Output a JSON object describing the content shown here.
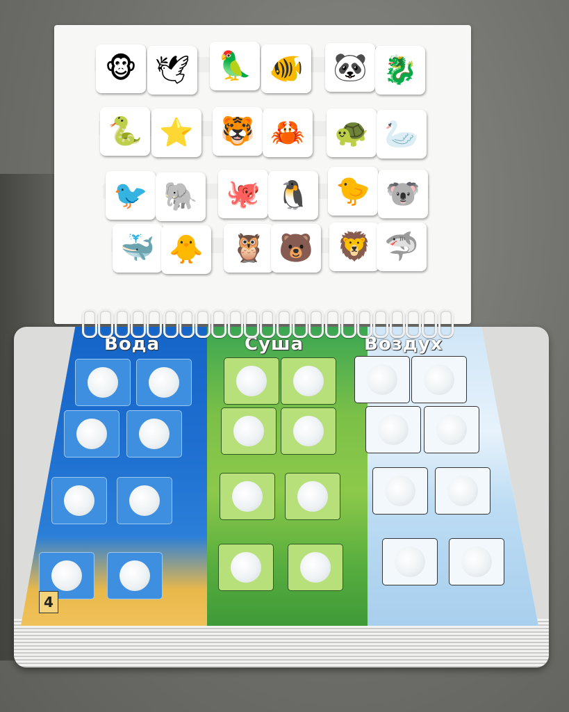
{
  "cards": [
    {
      "name": "monkey",
      "glyph": "🐵"
    },
    {
      "name": "seagull",
      "glyph": "🕊"
    },
    {
      "name": "parrot",
      "glyph": "🦜"
    },
    {
      "name": "tropical-fish",
      "glyph": "🐠"
    },
    {
      "name": "panda",
      "glyph": "🐼"
    },
    {
      "name": "seahorse",
      "glyph": "🐉"
    },
    {
      "name": "snake",
      "glyph": "🐍"
    },
    {
      "name": "starfish",
      "glyph": "⭐"
    },
    {
      "name": "tiger",
      "glyph": "🐯"
    },
    {
      "name": "crab",
      "glyph": "🦀"
    },
    {
      "name": "turtle",
      "glyph": "🐢"
    },
    {
      "name": "pelican",
      "glyph": "🦢"
    },
    {
      "name": "toucan",
      "glyph": "🐦"
    },
    {
      "name": "elephant",
      "glyph": "🐘"
    },
    {
      "name": "octopus",
      "glyph": "🐙"
    },
    {
      "name": "flying-toucan",
      "glyph": "🐧"
    },
    {
      "name": "red-bird",
      "glyph": "🐤"
    },
    {
      "name": "koala",
      "glyph": "🐨"
    },
    {
      "name": "whale",
      "glyph": "🐳"
    },
    {
      "name": "quail",
      "glyph": "🐥"
    },
    {
      "name": "owl",
      "glyph": "🦉"
    },
    {
      "name": "bear",
      "glyph": "🐻"
    },
    {
      "name": "lion",
      "glyph": "🦁"
    },
    {
      "name": "shark",
      "glyph": "🦈"
    }
  ],
  "columns": {
    "water": {
      "title": "Вода"
    },
    "land": {
      "title": "Суша"
    },
    "air": {
      "title": "Воздух"
    }
  },
  "page_number": "4"
}
